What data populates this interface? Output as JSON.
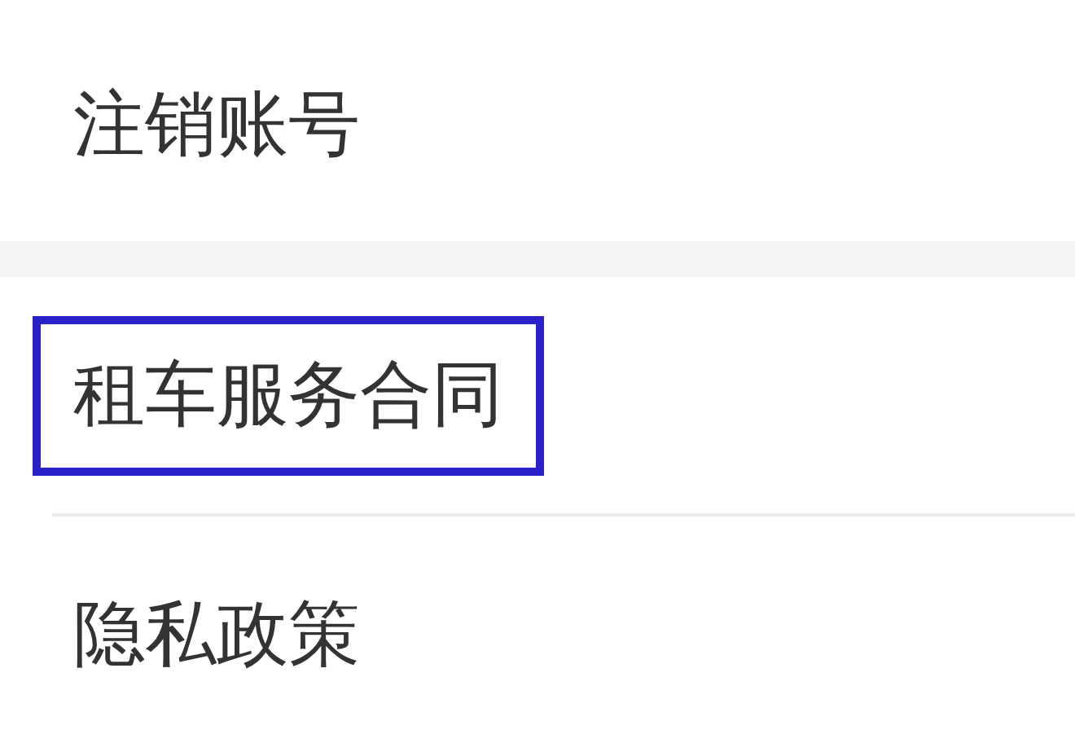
{
  "sections": [
    {
      "items": [
        {
          "label": "注销账号",
          "highlighted": false
        }
      ]
    },
    {
      "items": [
        {
          "label": "租车服务合同",
          "highlighted": true
        },
        {
          "label": "隐私政策",
          "highlighted": false
        }
      ]
    }
  ]
}
